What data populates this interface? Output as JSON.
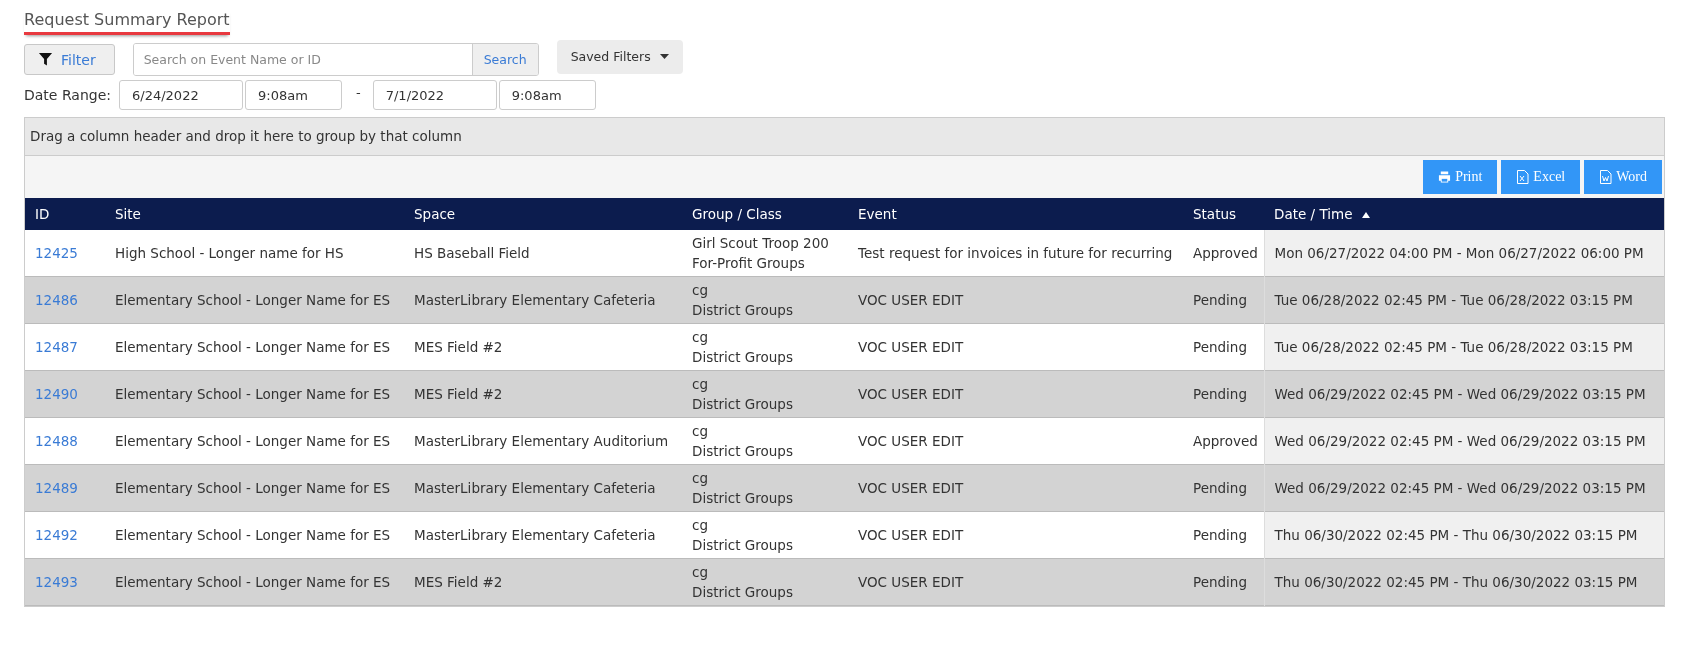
{
  "title": "Request Summary Report",
  "filter_button": {
    "label": "Filter"
  },
  "search": {
    "placeholder": "Search on Event Name or ID",
    "button": "Search"
  },
  "saved_filters": {
    "label": "Saved Filters"
  },
  "date_range": {
    "label": "Date Range:",
    "start_date": "6/24/2022",
    "start_time": "9:08am",
    "separator": "-",
    "end_date": "7/1/2022",
    "end_time": "9:08am"
  },
  "group_panel": {
    "text": "Drag a column header and drop it here to group by that column"
  },
  "export_buttons": [
    {
      "kind": "print",
      "label": "Print"
    },
    {
      "kind": "excel",
      "label": "Excel"
    },
    {
      "kind": "word",
      "label": "Word"
    }
  ],
  "table": {
    "columns": [
      {
        "label": "ID",
        "sorted": false
      },
      {
        "label": "Site",
        "sorted": false
      },
      {
        "label": "Space",
        "sorted": false
      },
      {
        "label": "Group / Class",
        "sorted": false
      },
      {
        "label": "Event",
        "sorted": false
      },
      {
        "label": "Status",
        "sorted": false
      },
      {
        "label": "Date / Time",
        "sorted": true
      }
    ],
    "rows": [
      {
        "id": "12425",
        "site": "High School - Longer name for HS",
        "space": "HS Baseball Field",
        "group": "Girl Scout Troop 200",
        "class": "For-Profit Groups",
        "event": "Test request for invoices in future for recurring",
        "status": "Approved",
        "datetime": "Mon 06/27/2022 04:00 PM - Mon 06/27/2022 06:00 PM"
      },
      {
        "id": "12486",
        "site": "Elementary School - Longer Name for ES",
        "space": "MasterLibrary Elementary Cafeteria",
        "group": "cg",
        "class": "District Groups",
        "event": "VOC USER EDIT",
        "status": "Pending",
        "datetime": "Tue 06/28/2022 02:45 PM - Tue 06/28/2022 03:15 PM"
      },
      {
        "id": "12487",
        "site": "Elementary School - Longer Name for ES",
        "space": "MES Field #2",
        "group": "cg",
        "class": "District Groups",
        "event": "VOC USER EDIT",
        "status": "Pending",
        "datetime": "Tue 06/28/2022 02:45 PM - Tue 06/28/2022 03:15 PM"
      },
      {
        "id": "12490",
        "site": "Elementary School - Longer Name for ES",
        "space": "MES Field #2",
        "group": "cg",
        "class": "District Groups",
        "event": "VOC USER EDIT",
        "status": "Pending",
        "datetime": "Wed 06/29/2022 02:45 PM - Wed 06/29/2022 03:15 PM"
      },
      {
        "id": "12488",
        "site": "Elementary School - Longer Name for ES",
        "space": "MasterLibrary Elementary Auditorium",
        "group": "cg",
        "class": "District Groups",
        "event": "VOC USER EDIT",
        "status": "Approved",
        "datetime": "Wed 06/29/2022 02:45 PM - Wed 06/29/2022 03:15 PM"
      },
      {
        "id": "12489",
        "site": "Elementary School - Longer Name for ES",
        "space": "MasterLibrary Elementary Cafeteria",
        "group": "cg",
        "class": "District Groups",
        "event": "VOC USER EDIT",
        "status": "Pending",
        "datetime": "Wed 06/29/2022 02:45 PM - Wed 06/29/2022 03:15 PM"
      },
      {
        "id": "12492",
        "site": "Elementary School - Longer Name for ES",
        "space": "MasterLibrary Elementary Cafeteria",
        "group": "cg",
        "class": "District Groups",
        "event": "VOC USER EDIT",
        "status": "Pending",
        "datetime": "Thu 06/30/2022 02:45 PM - Thu 06/30/2022 03:15 PM"
      },
      {
        "id": "12493",
        "site": "Elementary School - Longer Name for ES",
        "space": "MES Field #2",
        "group": "cg",
        "class": "District Groups",
        "event": "VOC USER EDIT",
        "status": "Pending",
        "datetime": "Thu 06/30/2022 02:45 PM - Thu 06/30/2022 03:15 PM"
      }
    ]
  }
}
